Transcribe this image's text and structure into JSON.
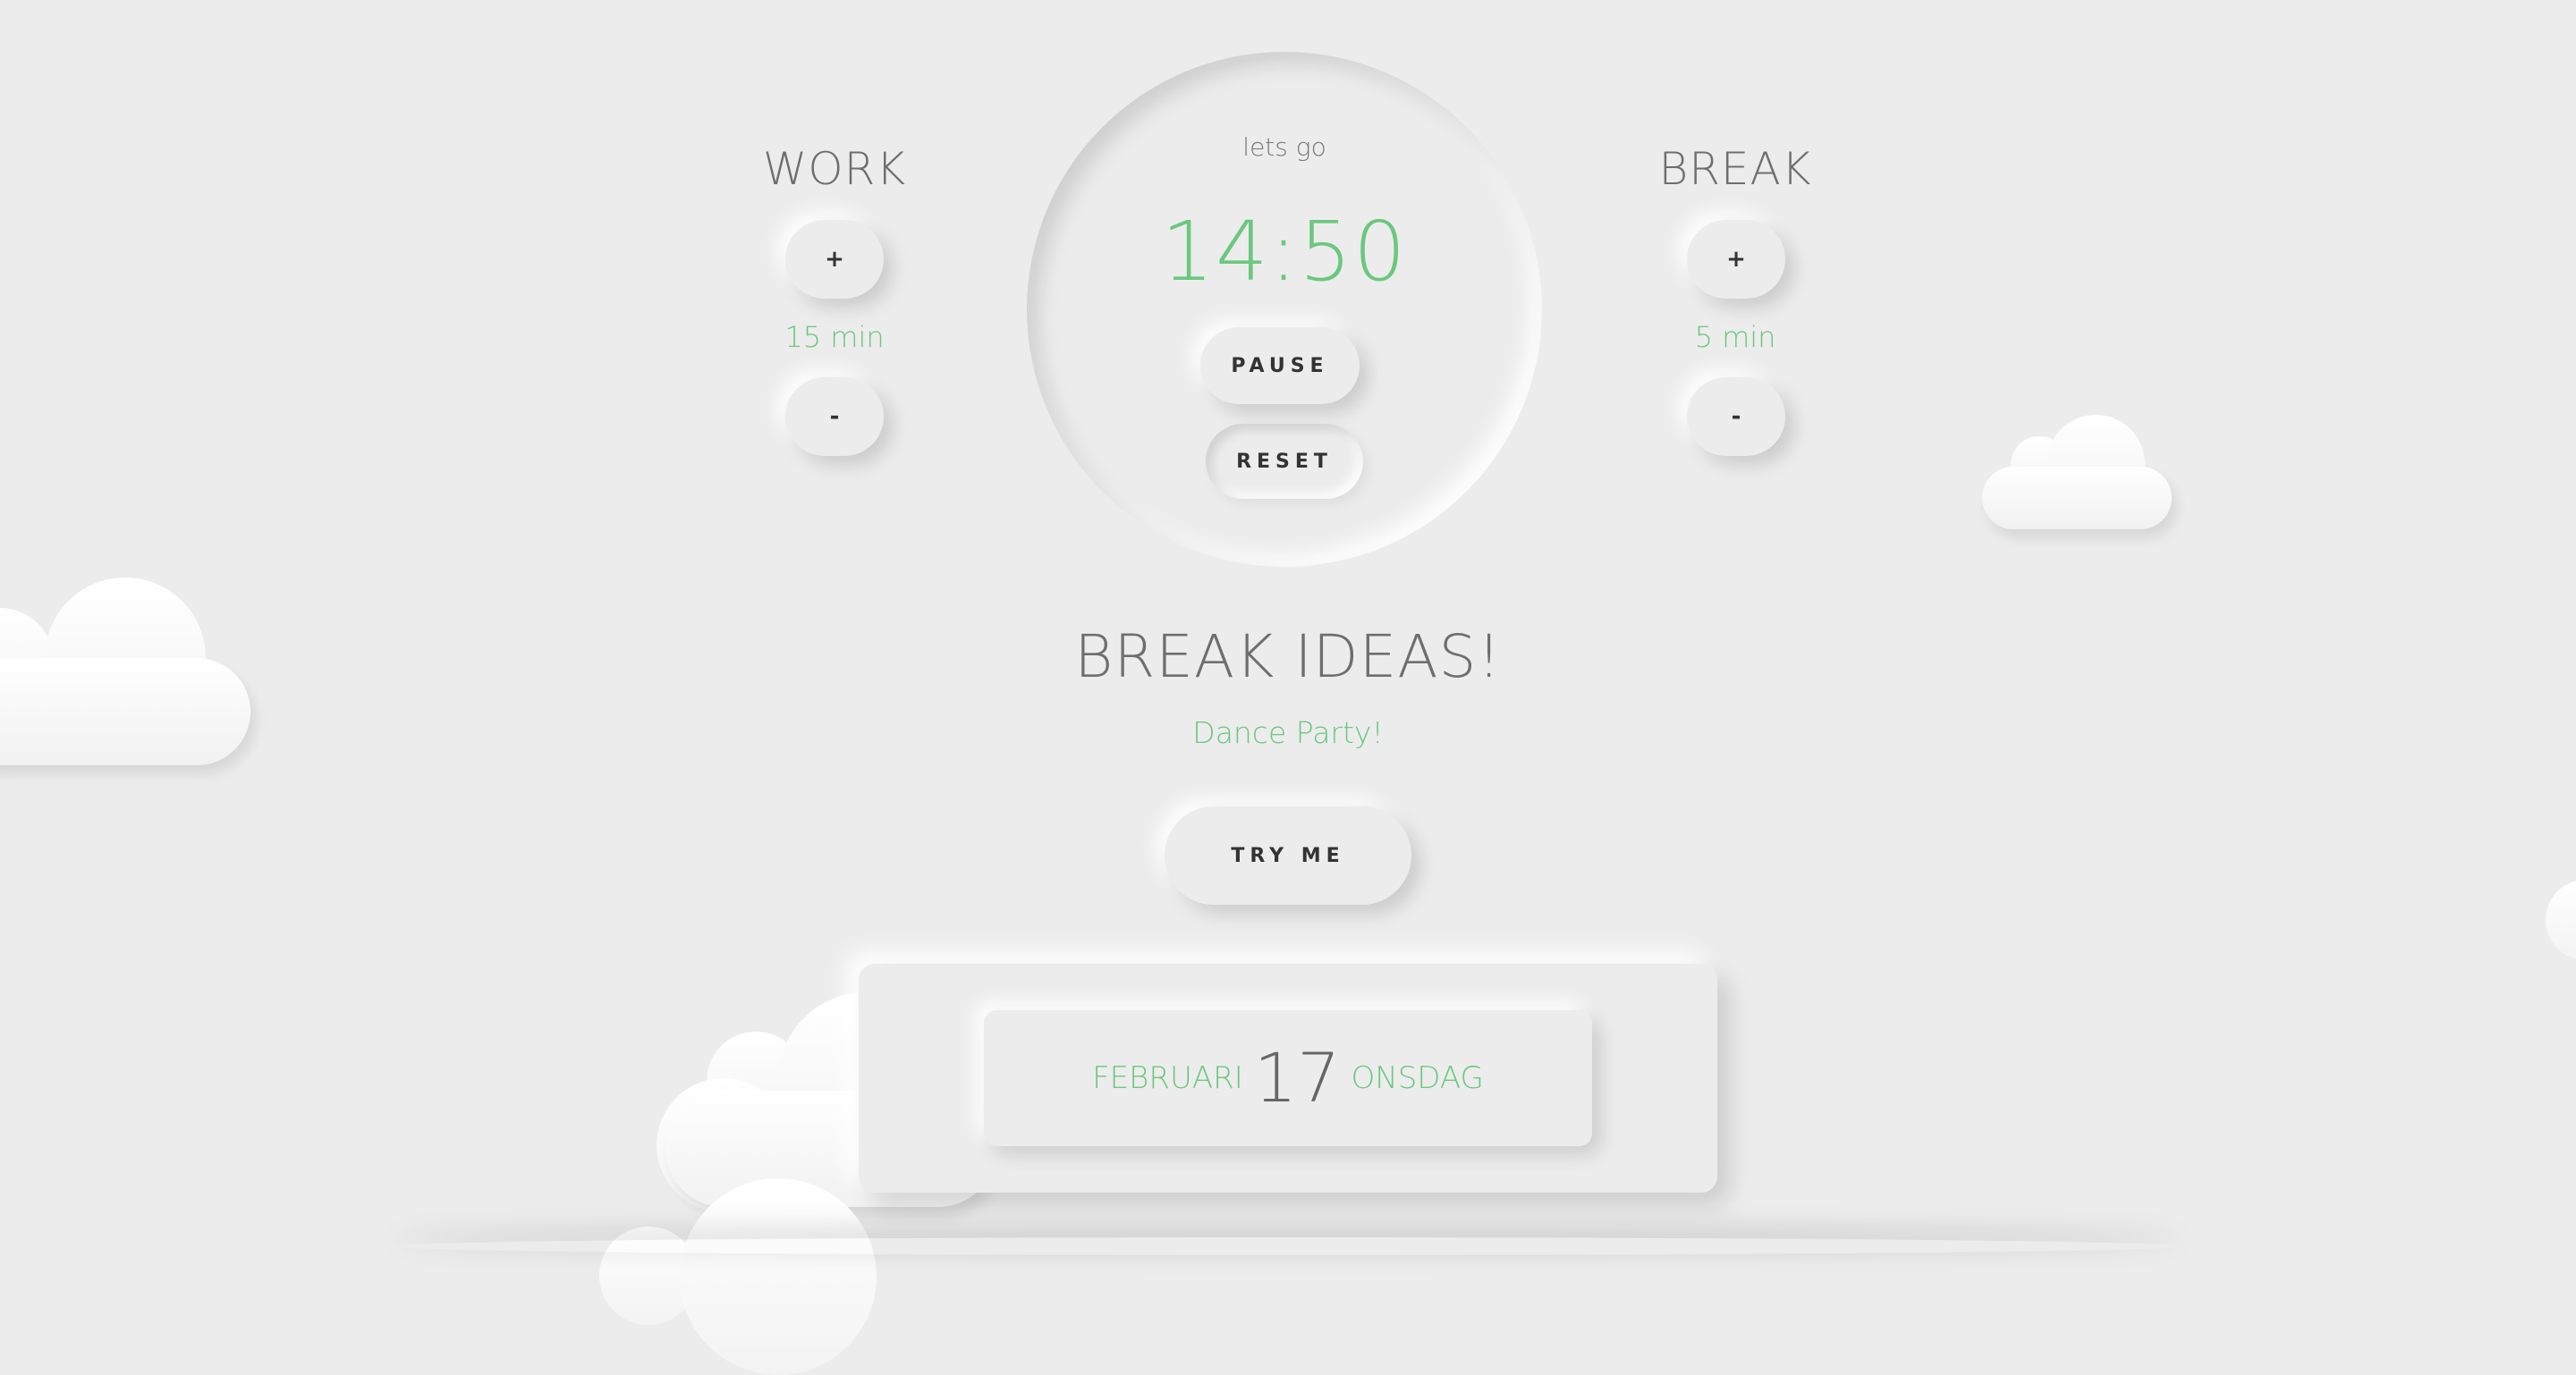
{
  "work": {
    "title": "WORK",
    "increment_label": "+",
    "decrement_label": "-",
    "value_text": "15 min"
  },
  "break": {
    "title": "BREAK",
    "increment_label": "+",
    "decrement_label": "-",
    "value_text": "5 min"
  },
  "timer": {
    "status": "lets go",
    "time": "14:50",
    "pause_label": "PAUSE",
    "reset_label": "RESET"
  },
  "ideas": {
    "heading": "BREAK IDEAS!",
    "current_idea": "Dance Party!",
    "try_label": "TRY ME"
  },
  "date": {
    "month": "FEBRUARI",
    "day": "17",
    "weekday": "ONSDAG"
  },
  "colors": {
    "background": "#ececec",
    "accent_green": "#6cc77f",
    "heading_gray": "#6e6e6e"
  }
}
